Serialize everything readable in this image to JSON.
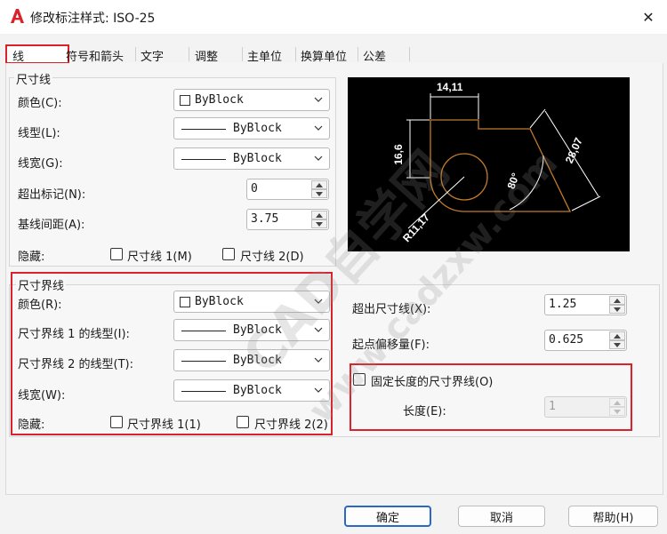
{
  "window": {
    "title": "修改标注样式: ISO-25",
    "close_glyph": "✕"
  },
  "tabs": [
    {
      "label": "线"
    },
    {
      "label": "符号和箭头"
    },
    {
      "label": "文字"
    },
    {
      "label": "调整"
    },
    {
      "label": "主单位"
    },
    {
      "label": "换算单位"
    },
    {
      "label": "公差"
    }
  ],
  "dimension_lines": {
    "title": "尺寸线",
    "color_label": "颜色(C):",
    "color_value": "ByBlock",
    "linetype_label": "线型(L):",
    "linetype_value": "ByBlock",
    "lineweight_label": "线宽(G):",
    "lineweight_value": "ByBlock",
    "extend_ticks_label": "超出标记(N):",
    "extend_ticks_value": "0",
    "baseline_spacing_label": "基线间距(A):",
    "baseline_spacing_value": "3.75",
    "suppress_label": "隐藏:",
    "suppress_dim1": "尺寸线 1(M)",
    "suppress_dim2": "尺寸线 2(D)"
  },
  "extension_lines": {
    "title": "尺寸界线",
    "color_label": "颜色(R):",
    "color_value": "ByBlock",
    "linetype1_label": "尺寸界线 1 的线型(I):",
    "linetype1_value": "ByBlock",
    "linetype2_label": "尺寸界线 2 的线型(T):",
    "linetype2_value": "ByBlock",
    "lineweight_label": "线宽(W):",
    "lineweight_value": "ByBlock",
    "suppress_label": "隐藏:",
    "suppress_ext1": "尺寸界线 1(1)",
    "suppress_ext2": "尺寸界线 2(2)",
    "extend_beyond_label": "超出尺寸线(X):",
    "extend_beyond_value": "1.25",
    "offset_label": "起点偏移量(F):",
    "offset_value": "0.625",
    "fixed_length_label": "固定长度的尺寸界线(O)",
    "length_label": "长度(E):",
    "length_value": "1"
  },
  "preview": {
    "dim_top": "14,11",
    "dim_left": "16,6",
    "dim_right": "28,07",
    "dim_angle": "80°",
    "dim_radius": "R11,17"
  },
  "buttons": {
    "ok": "确定",
    "cancel": "取消",
    "help": "帮助(H)"
  },
  "colors": {
    "preview_bg": "#000000",
    "dim_white": "#ffffff",
    "geometry": "#c27a2c",
    "highlight": "#d9222a",
    "primary_border": "#2a68c8"
  },
  "icons": {
    "app": "autocad-logo-icon",
    "close": "close-icon",
    "dropdown": "chevron-down-icon",
    "spin": "spin-arrows-icon"
  }
}
